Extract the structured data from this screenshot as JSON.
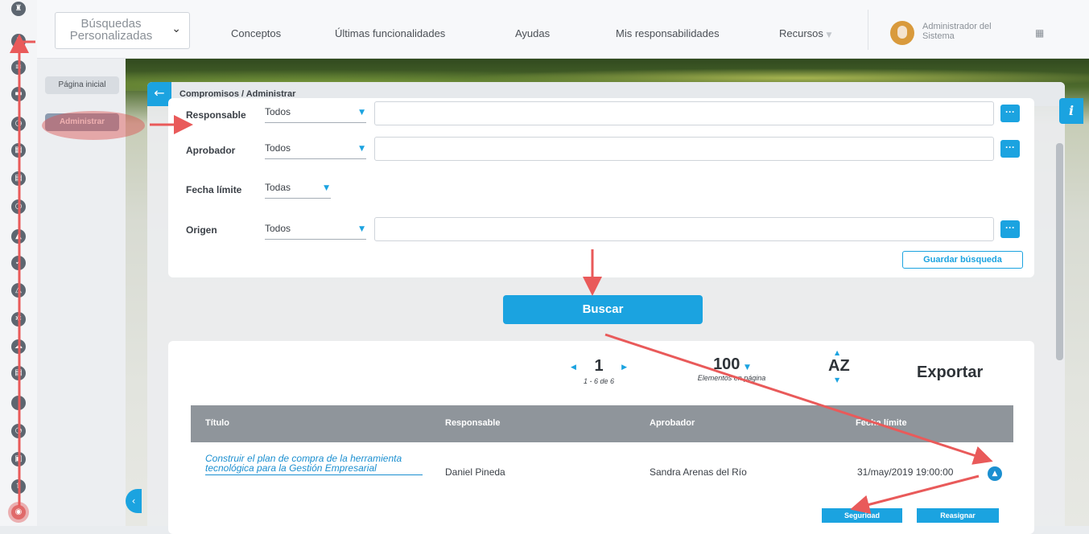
{
  "header": {
    "search_label": "Búsquedas Personalizadas",
    "nav": [
      "Conceptos",
      "Últimas funcionalidades",
      "Ayudas",
      "Mis responsabilidades",
      "Recursos"
    ],
    "user_name": "Administrador del Sistema"
  },
  "sidebar": {
    "home_label": "Página inicial",
    "admin_label": "Administrar"
  },
  "panel": {
    "breadcrumb": "Compromisos / Administrar",
    "filters": [
      {
        "label": "Responsable",
        "value": "Todos"
      },
      {
        "label": "Aprobador",
        "value": "Todos"
      },
      {
        "label": "Fecha límite",
        "value": "Todas"
      },
      {
        "label": "Origen",
        "value": "Todos"
      }
    ],
    "dots_label": "···",
    "save_search": "Guardar búsqueda",
    "search_button": "Buscar"
  },
  "results": {
    "page": "1",
    "range": "1 - 6 de 6",
    "per_page": "100",
    "per_page_label": "Elementos en página",
    "sort_label": "AZ",
    "export_label": "Exportar",
    "columns": [
      "Título",
      "Responsable",
      "Aprobador",
      "Fecha límite"
    ],
    "rows": [
      {
        "title": "Construir el plan de compra de la herramienta tecnológica para la Gestión Empresarial",
        "responsable": "Daniel Pineda",
        "aprobador": "Sandra Arenas del Río",
        "fecha": "31/may/2019 19:00:00",
        "actions": [
          "Seguridad",
          "Reasignar"
        ]
      }
    ]
  },
  "colors": {
    "accent": "#1ba3e0",
    "annotation": "#e95a5a"
  }
}
